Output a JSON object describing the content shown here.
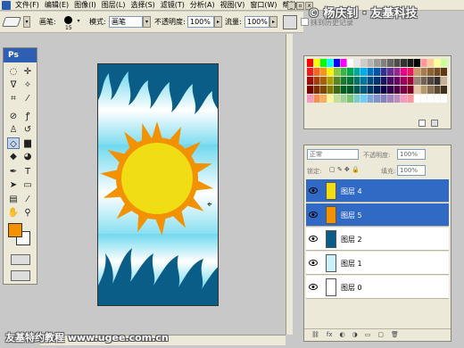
{
  "menubar": {
    "items": [
      "文件(F)",
      "编辑(E)",
      "图像(I)",
      "图层(L)",
      "选择(S)",
      "滤镜(T)",
      "分析(A)",
      "视图(V)",
      "窗口(W)",
      "帮助(H)"
    ],
    "window_buttons": [
      "_",
      "▫",
      "x"
    ]
  },
  "watermark": {
    "top": "© 杨庆钊 · 友基科技",
    "bottom": "友基特约教程  www.ugee.com.cn"
  },
  "options": {
    "brush_label": "画笔:",
    "brush_size": "15",
    "mode_label": "模式:",
    "mode_value": "画笔",
    "opacity_label": "不透明度:",
    "opacity_value": "100%",
    "flow_label": "流量:",
    "flow_value": "100%",
    "erase_history_label": "抹到历史记录"
  },
  "toolbox": {
    "logo": "Ps",
    "foreground_color": "#f39200",
    "background_color": "#ffffff"
  },
  "layers": {
    "blend_mode": "正常",
    "opacity_label": "不透明度:",
    "opacity_value": "100%",
    "lock_label": "锁定:",
    "fill_label": "填充:",
    "fill_value": "100%",
    "items": [
      {
        "name": "图层 4",
        "selected": true,
        "thumb": "sun"
      },
      {
        "name": "图层 5",
        "selected": true,
        "thumb": "sun-orange"
      },
      {
        "name": "图层 2",
        "selected": false,
        "thumb": "flames"
      },
      {
        "name": "图层 1",
        "selected": false,
        "thumb": "gradient"
      },
      {
        "name": "图层 0",
        "selected": false,
        "thumb": "white"
      }
    ],
    "footer": [
      "⛓",
      "fx",
      "◐",
      "◑",
      "▭",
      "▢",
      "🗑"
    ]
  },
  "colors": {
    "sun_yellow": "#f1dd13",
    "sun_orange": "#f39200",
    "flame_blue": "#0a5d86",
    "sky_light": "#c9f2fb",
    "selection_blue": "#316ac5"
  }
}
